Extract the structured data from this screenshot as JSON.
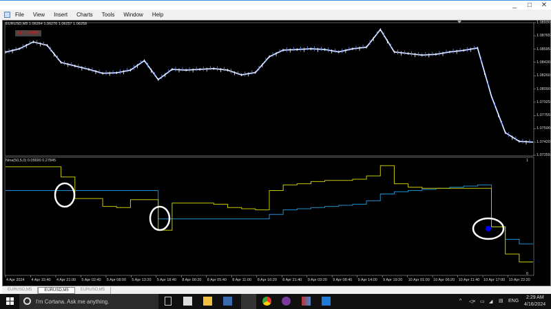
{
  "window": {
    "controls": [
      "_",
      "□",
      "✕"
    ]
  },
  "menu": [
    "File",
    "View",
    "Insert",
    "Charts",
    "Tools",
    "Window",
    "Help"
  ],
  "chart": {
    "header": "EURUSD,M5  1.06264 1.06276 1.06257 1.06258",
    "keltner_label": "KELTNER",
    "indicator_header": "Nina(50,5,0) 0.05690 0.27845",
    "indicator_scale": [
      "1",
      "0"
    ],
    "colors": {
      "candles_up": "#ffffff",
      "candles_down": "#6f8fe8",
      "yellow_line": "#c8c800",
      "blue_line": "#1e90d0",
      "annotation": "#ffffff",
      "dot": "#0000ff"
    }
  },
  "chart_data": [
    {
      "type": "line",
      "title": "EURUSD,M5",
      "ylim": [
        1.07255,
        1.0893
      ],
      "yticks": [
        "1.08930",
        "1.08765",
        "1.08595",
        "1.08430",
        "1.08260",
        "1.08090",
        "1.07925",
        "1.07755",
        "1.07590",
        "1.07420",
        "1.07255"
      ],
      "xticks": [
        "4 Apr 2024",
        "4 Apr 15:40",
        "4 Apr 21:00",
        "5 Apr 02:40",
        "5 Apr 08:00",
        "5 Apr 13:20",
        "5 Apr 18:40",
        "8 Apr 00:20",
        "8 Apr 05:40",
        "8 Apr 11:00",
        "8 Apr 16:20",
        "8 Apr 21:40",
        "9 Apr 03:20",
        "9 Apr 08:40",
        "9 Apr 14:00",
        "9 Apr 19:20",
        "10 Apr 01:00",
        "10 Apr 06:20",
        "10 Apr 11:40",
        "10 Apr 17:00",
        "10 Apr 22:20"
      ],
      "values": [
        1.08557,
        1.086,
        1.08687,
        1.08644,
        1.08427,
        1.08383,
        1.0834,
        1.0829,
        1.08296,
        1.0833,
        1.0845,
        1.0821,
        1.0834,
        1.0833,
        1.0834,
        1.0835,
        1.0833,
        1.0827,
        1.083,
        1.085,
        1.08583,
        1.0859,
        1.086,
        1.0859,
        1.0856,
        1.086,
        1.0862,
        1.08843,
        1.0856,
        1.0854,
        1.0852,
        1.0853,
        1.0856,
        1.0858,
        1.0861,
        1.08,
        1.0754,
        1.0743,
        1.0742
      ]
    },
    {
      "type": "line",
      "title": "Nina(50,5,0)",
      "ylim": [
        0,
        1
      ],
      "series": [
        {
          "values": [
            0.94,
            0.94,
            0.94,
            0.94,
            0.85,
            0.66,
            0.66,
            0.59,
            0.58,
            0.65,
            0.65,
            0.38,
            0.62,
            0.62,
            0.62,
            0.61,
            0.58,
            0.57,
            0.56,
            0.73,
            0.78,
            0.79,
            0.81,
            0.82,
            0.82,
            0.83,
            0.86,
            0.95,
            0.79,
            0.76,
            0.75,
            0.75,
            0.75,
            0.75,
            0.75,
            0.41,
            0.17,
            0.1,
            0.1
          ]
        },
        {
          "values": [
            0.73,
            0.73,
            0.73,
            0.73,
            0.73,
            0.73,
            0.73,
            0.73,
            0.73,
            0.73,
            0.73,
            0.48,
            0.48,
            0.48,
            0.48,
            0.48,
            0.48,
            0.48,
            0.48,
            0.52,
            0.56,
            0.57,
            0.58,
            0.59,
            0.6,
            0.61,
            0.64,
            0.7,
            0.72,
            0.73,
            0.74,
            0.75,
            0.76,
            0.77,
            0.78,
            0.41,
            0.3,
            0.26,
            0.26
          ]
        }
      ]
    }
  ],
  "tabs": [
    "EURUSD,M5",
    "EURUSD,M5",
    "EURUSD,M5"
  ],
  "taskbar": {
    "search_placeholder": "I'm Cortana. Ask me anything.",
    "lang": "ENG",
    "time": "2:29 AM",
    "date": "4/16/2024"
  }
}
